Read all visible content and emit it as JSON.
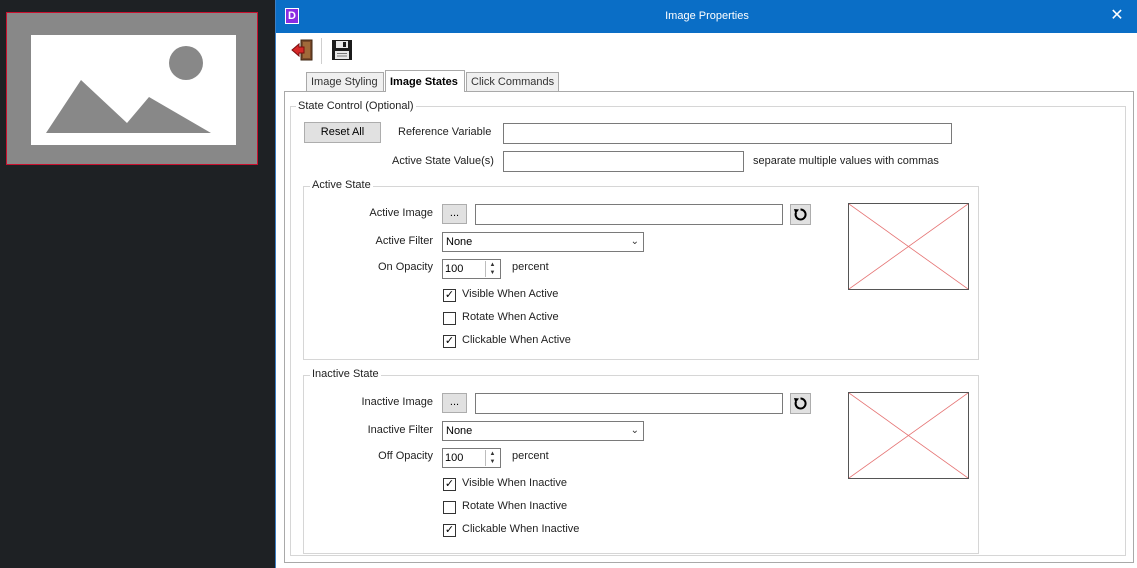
{
  "dialog": {
    "title": "Image Properties",
    "app_icon_letter": "D",
    "close_glyph": "✕"
  },
  "tabs": [
    {
      "label": "Image Styling"
    },
    {
      "label": "Image States"
    },
    {
      "label": "Click Commands"
    }
  ],
  "state_control": {
    "legend": "State Control (Optional)",
    "reset_label": "Reset All",
    "reference_variable_label": "Reference Variable",
    "reference_variable_value": "",
    "active_state_values_label": "Active State Value(s)",
    "active_state_values_value": "",
    "hint": "separate multiple values with commas"
  },
  "active_state": {
    "legend": "Active State",
    "image_label": "Active Image",
    "browse_label": "...",
    "image_value": "",
    "filter_label": "Active Filter",
    "filter_value": "None",
    "opacity_label": "On Opacity",
    "opacity_value": "100",
    "opacity_unit": "percent",
    "visible_label": "Visible When Active",
    "rotate_label": "Rotate When Active",
    "clickable_label": "Clickable When Active",
    "visible_checked": "✓",
    "rotate_checked": "",
    "clickable_checked": "✓"
  },
  "inactive_state": {
    "legend": "Inactive State",
    "image_label": "Inactive Image",
    "browse_label": "...",
    "image_value": "",
    "filter_label": "Inactive Filter",
    "filter_value": "None",
    "opacity_label": "Off Opacity",
    "opacity_value": "100",
    "opacity_unit": "percent",
    "visible_label": "Visible When Inactive",
    "rotate_label": "Rotate When Inactive",
    "clickable_label": "Clickable When Inactive",
    "visible_checked": "✓",
    "rotate_checked": "",
    "clickable_checked": "✓"
  },
  "icons": {
    "exit": "exit-icon",
    "save": "save-icon",
    "reset_image": "reset-icon",
    "placeholder": "image-placeholder-icon"
  },
  "colors": {
    "titlebar": "#0a6ec6",
    "preview_border": "#c8102e",
    "placeholder_cross": "#e57373"
  }
}
